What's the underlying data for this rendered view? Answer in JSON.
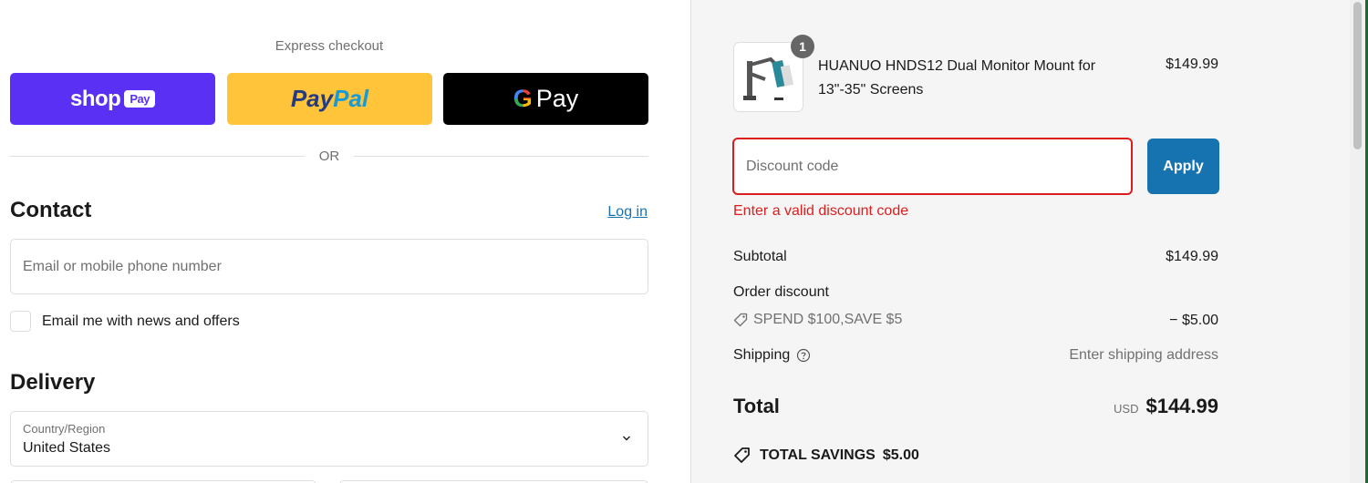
{
  "express": {
    "title": "Express checkout",
    "shop_pay": {
      "word": "shop",
      "badge": "Pay"
    },
    "paypal": {
      "part1": "Pay",
      "part2": "Pal"
    },
    "gpay": {
      "g": "G",
      "pay": "Pay"
    },
    "or_text": "OR"
  },
  "contact": {
    "title": "Contact",
    "login": "Log in",
    "email_placeholder": "Email or mobile phone number",
    "newsletter_label": "Email me with news and offers"
  },
  "delivery": {
    "title": "Delivery",
    "country_label": "Country/Region",
    "country_value": "United States"
  },
  "summary": {
    "product": {
      "name": "HUANUO HNDS12 Dual Monitor Mount for 13\"-35\" Screens",
      "price": "$149.99",
      "quantity": "1"
    },
    "discount": {
      "placeholder": "Discount code",
      "apply": "Apply",
      "error": "Enter a valid discount code"
    },
    "subtotal_label": "Subtotal",
    "subtotal_value": "$149.99",
    "order_discount_label": "Order discount",
    "discount_name": "SPEND $100,SAVE $5",
    "discount_amount": "− $5.00",
    "shipping_label": "Shipping",
    "shipping_value": "Enter shipping address",
    "total_label": "Total",
    "currency": "USD",
    "total_value": "$144.99",
    "savings_label": "TOTAL SAVINGS",
    "savings_value": "$5.00"
  },
  "colors": {
    "shop_pay": "#5a31f4",
    "paypal": "#ffc439",
    "accent": "#1773b0",
    "error": "#dd1d1d"
  },
  "icons": [
    "chevron-down-icon",
    "tag-icon",
    "help-icon",
    "savings-tag-icon"
  ]
}
